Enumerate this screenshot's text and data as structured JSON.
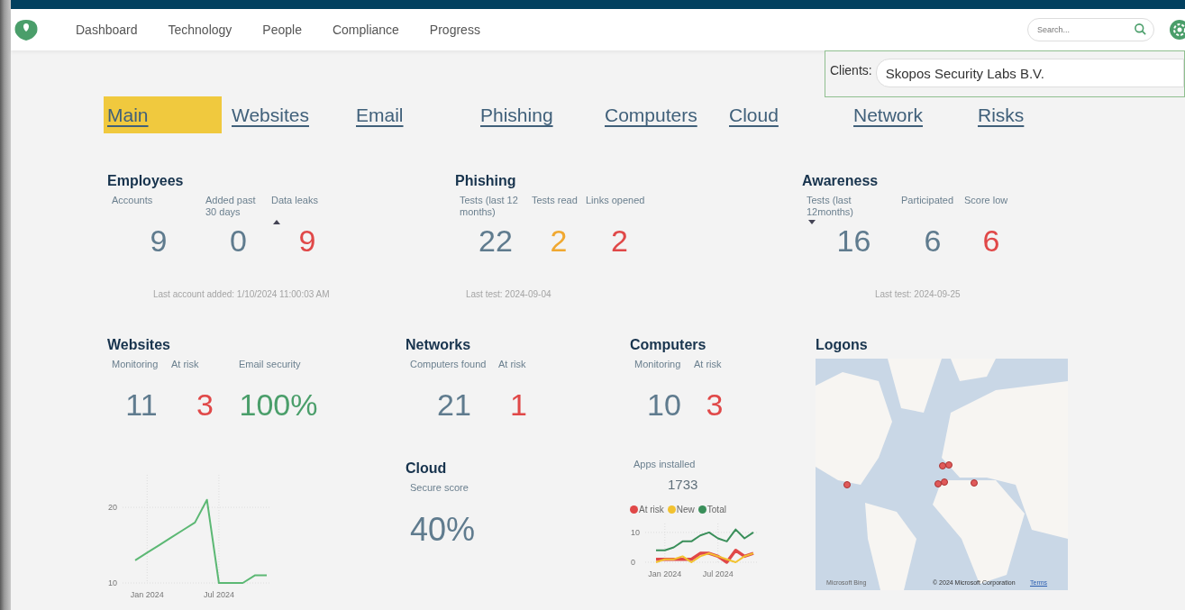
{
  "nav": {
    "items": [
      "Dashboard",
      "Technology",
      "People",
      "Compliance",
      "Progress"
    ],
    "search": {
      "placeholder": "Search..."
    }
  },
  "clients": {
    "label": "Clients:",
    "value": "Skopos Security Labs B.V."
  },
  "tabs": [
    {
      "label": "Main",
      "selected": true
    },
    {
      "label": "Websites",
      "selected": false
    },
    {
      "label": "Email",
      "selected": false
    },
    {
      "label": "Phishing",
      "selected": false
    },
    {
      "label": "Computers",
      "selected": false
    },
    {
      "label": "Cloud",
      "selected": false
    },
    {
      "label": "Network",
      "selected": false
    },
    {
      "label": "Risks",
      "selected": false
    }
  ],
  "top_cards": [
    {
      "title": "Employees",
      "metrics": [
        {
          "label": "Accounts",
          "value": "9",
          "color": "#5f7b8e",
          "sorted_asc": false,
          "sorted_desc": false
        },
        {
          "label": "Added past 30 days",
          "value": "0",
          "color": "#5f7b8e",
          "sorted_asc": false,
          "sorted_desc": false
        },
        {
          "label": "Data leaks",
          "value": "9",
          "color": "#e04848",
          "sorted_asc": true,
          "sorted_desc": false
        }
      ],
      "footer": "Last account added: 1/10/2024 11:00:03 AM"
    },
    {
      "title": "Phishing",
      "metrics": [
        {
          "label": "Tests (last 12 months)",
          "value": "22",
          "color": "#5f7b8e",
          "sorted_asc": false,
          "sorted_desc": false
        },
        {
          "label": "Tests read",
          "value": "2",
          "color": "#f0a830",
          "sorted_asc": false,
          "sorted_desc": false
        },
        {
          "label": "Links opened",
          "value": "2",
          "color": "#e04848",
          "sorted_asc": false,
          "sorted_desc": false
        }
      ],
      "footer": "Last test: 2024-09-04"
    },
    {
      "title": "Awareness",
      "metrics": [
        {
          "label": "Tests (last 12months)",
          "value": "16",
          "color": "#5f7b8e",
          "sorted_asc": false,
          "sorted_desc": true
        },
        {
          "label": "Participated",
          "value": "6",
          "color": "#5f7b8e",
          "sorted_asc": false,
          "sorted_desc": false
        },
        {
          "label": "Score low",
          "value": "6",
          "color": "#e04848",
          "sorted_asc": false,
          "sorted_desc": false
        }
      ],
      "footer": "Last test: 2024-09-25"
    }
  ],
  "websites": {
    "title": "Websites",
    "metrics": [
      {
        "label": "Monitoring",
        "value": "11",
        "color": "#5f7b8e"
      },
      {
        "label": "At risk",
        "value": "3",
        "color": "#e04848"
      },
      {
        "label": "Email security",
        "value": "100%",
        "color": "#4a9e6a"
      }
    ],
    "chart_data": {
      "type": "line",
      "categories": [
        null,
        "Jan 2024",
        null,
        null,
        null,
        null,
        null,
        "Jul 2024",
        null,
        null,
        null,
        null
      ],
      "series": [
        {
          "color": "#5cb874",
          "values": [
            13,
            14,
            15,
            16,
            17,
            18,
            21,
            10,
            10,
            10,
            11,
            11
          ]
        }
      ],
      "yticks": [
        10,
        20
      ],
      "ylim": [
        10,
        24.3
      ],
      "grid": true
    }
  },
  "networks": {
    "title": "Networks",
    "metrics": [
      {
        "label": "Computers found",
        "value": "21",
        "color": "#5f7b8e"
      },
      {
        "label": "At risk",
        "value": "1",
        "color": "#e04848"
      }
    ]
  },
  "cloud": {
    "title": "Cloud",
    "metrics": [
      {
        "label": "Secure score",
        "value": "40%",
        "color": "#5f7b8e"
      }
    ]
  },
  "computers": {
    "title": "Computers",
    "metrics": [
      {
        "label": "Monitoring",
        "value": "10",
        "color": "#5f7b8e"
      },
      {
        "label": "At risk",
        "value": "3",
        "color": "#e04848"
      }
    ],
    "apps": {
      "label": "Apps installed",
      "value": "1733"
    },
    "chart_data": {
      "type": "line",
      "categories": [
        null,
        "Jan 2024",
        null,
        null,
        null,
        null,
        null,
        "Jul 2024",
        null,
        null,
        null,
        null
      ],
      "series": [
        {
          "name": "At risk",
          "color": "#e04848",
          "values": [
            1,
            1,
            1,
            1,
            1,
            3,
            3,
            2,
            0,
            4,
            2,
            3
          ]
        },
        {
          "name": "New",
          "color": "#f2c230",
          "values": [
            0,
            1,
            1,
            2,
            0,
            2,
            3,
            2,
            1,
            0,
            2,
            3
          ]
        },
        {
          "name": "Total",
          "color": "#3a8f5a",
          "values": [
            4,
            4,
            5,
            7,
            7,
            9,
            10,
            8,
            7,
            11,
            8,
            10
          ]
        }
      ],
      "yticks": [
        0,
        10
      ],
      "ylim": [
        0,
        13
      ],
      "grid": true
    }
  },
  "logons": {
    "title": "Logons",
    "map": {
      "kind": "picture",
      "attribution": "Microsoft Bing",
      "copyright": "© 2024 Microsoft Corporation",
      "terms": "Terms"
    }
  }
}
